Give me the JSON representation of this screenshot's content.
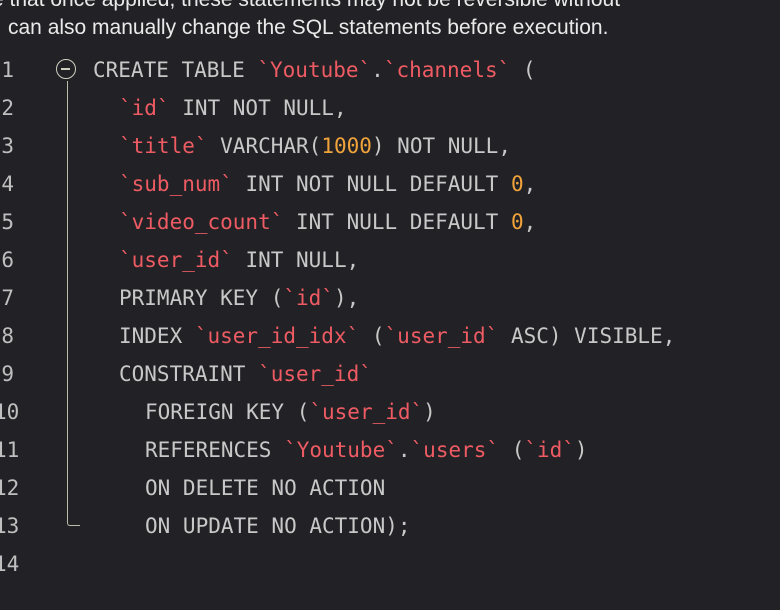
{
  "notice": {
    "line1": "e that once applied, these statements may not be reversible without ",
    "line2": "can also manually change the SQL statements before execution."
  },
  "editor": {
    "language": "sql",
    "fold_icon": "collapse-minus-circle-icon",
    "colors": {
      "background": "#222226",
      "keyword": "#c8c8c8",
      "identifier": "#ee5b63",
      "number": "#f0a33b",
      "line_number": "#bfbfbf",
      "fold_guide": "#bcbcaa"
    },
    "lines": [
      {
        "num": "1",
        "indent": "",
        "tokens": [
          {
            "t": "kw",
            "v": "CREATE TABLE "
          },
          {
            "t": "id",
            "v": "`Youtube`"
          },
          {
            "t": "pn",
            "v": "."
          },
          {
            "t": "id",
            "v": "`channels`"
          },
          {
            "t": "pn",
            "v": " ("
          }
        ]
      },
      {
        "num": "2",
        "indent": "  ",
        "tokens": [
          {
            "t": "id",
            "v": "`id`"
          },
          {
            "t": "kw",
            "v": " INT NOT NULL,"
          }
        ]
      },
      {
        "num": "3",
        "indent": "  ",
        "tokens": [
          {
            "t": "id",
            "v": "`title`"
          },
          {
            "t": "kw",
            "v": " VARCHAR("
          },
          {
            "t": "num",
            "v": "1000"
          },
          {
            "t": "kw",
            "v": ") NOT NULL,"
          }
        ]
      },
      {
        "num": "4",
        "indent": "  ",
        "tokens": [
          {
            "t": "id",
            "v": "`sub_num`"
          },
          {
            "t": "kw",
            "v": " INT NOT NULL DEFAULT "
          },
          {
            "t": "num",
            "v": "0"
          },
          {
            "t": "pn",
            "v": ","
          }
        ]
      },
      {
        "num": "5",
        "indent": "  ",
        "tokens": [
          {
            "t": "id",
            "v": "`video_count`"
          },
          {
            "t": "kw",
            "v": " INT NULL DEFAULT "
          },
          {
            "t": "num",
            "v": "0"
          },
          {
            "t": "pn",
            "v": ","
          }
        ]
      },
      {
        "num": "6",
        "indent": "  ",
        "tokens": [
          {
            "t": "id",
            "v": "`user_id`"
          },
          {
            "t": "kw",
            "v": " INT NULL,"
          }
        ]
      },
      {
        "num": "7",
        "indent": "  ",
        "tokens": [
          {
            "t": "kw",
            "v": "PRIMARY KEY ("
          },
          {
            "t": "id",
            "v": "`id`"
          },
          {
            "t": "pn",
            "v": "),"
          }
        ]
      },
      {
        "num": "8",
        "indent": "  ",
        "tokens": [
          {
            "t": "kw",
            "v": "INDEX "
          },
          {
            "t": "id",
            "v": "`user_id_idx`"
          },
          {
            "t": "pn",
            "v": " ("
          },
          {
            "t": "id",
            "v": "`user_id`"
          },
          {
            "t": "kw",
            "v": " ASC) VISIBLE,"
          }
        ]
      },
      {
        "num": "9",
        "indent": "  ",
        "tokens": [
          {
            "t": "kw",
            "v": "CONSTRAINT "
          },
          {
            "t": "id",
            "v": "`user_id`"
          }
        ]
      },
      {
        "num": "10",
        "indent": "    ",
        "tokens": [
          {
            "t": "kw",
            "v": "FOREIGN KEY ("
          },
          {
            "t": "id",
            "v": "`user_id`"
          },
          {
            "t": "pn",
            "v": ")"
          }
        ]
      },
      {
        "num": "11",
        "indent": "    ",
        "tokens": [
          {
            "t": "kw",
            "v": "REFERENCES "
          },
          {
            "t": "id",
            "v": "`Youtube`"
          },
          {
            "t": "pn",
            "v": "."
          },
          {
            "t": "id",
            "v": "`users`"
          },
          {
            "t": "pn",
            "v": " ("
          },
          {
            "t": "id",
            "v": "`id`"
          },
          {
            "t": "pn",
            "v": ")"
          }
        ]
      },
      {
        "num": "12",
        "indent": "    ",
        "tokens": [
          {
            "t": "kw",
            "v": "ON DELETE NO ACTION"
          }
        ]
      },
      {
        "num": "13",
        "indent": "    ",
        "tokens": [
          {
            "t": "kw",
            "v": "ON UPDATE NO ACTION);"
          }
        ]
      },
      {
        "num": "14",
        "indent": "",
        "tokens": []
      }
    ]
  }
}
